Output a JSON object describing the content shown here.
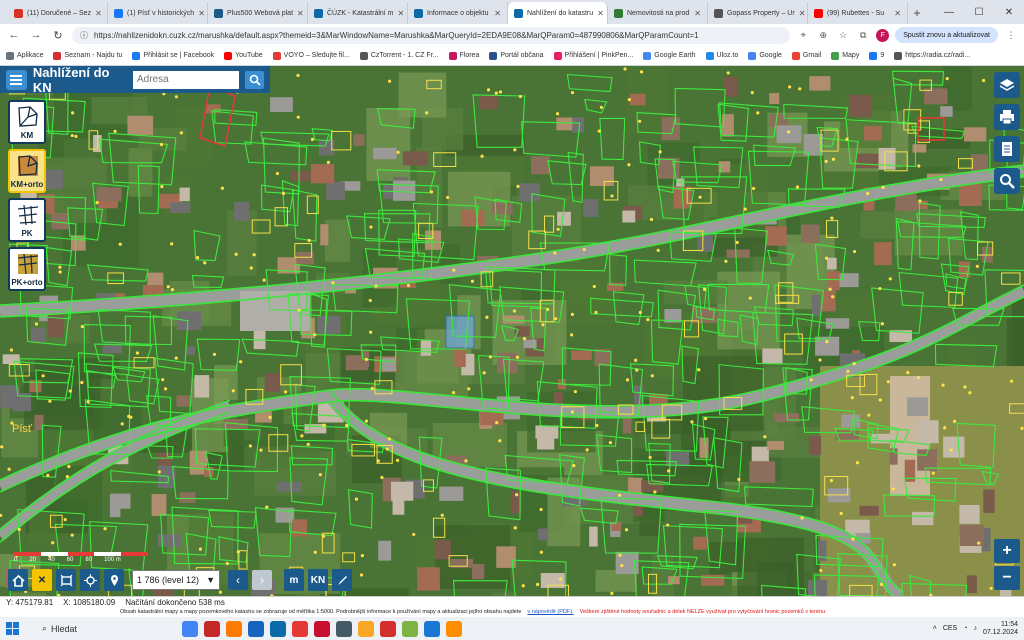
{
  "browser": {
    "tabs": [
      {
        "title": "(11) Doručené – Sez",
        "color": "#d93025"
      },
      {
        "title": "(1) Písť v historických",
        "color": "#1877f2"
      },
      {
        "title": "Plus500 Webová plat",
        "color": "#1c5a8c"
      },
      {
        "title": "ČÚZK - Katastrální m",
        "color": "#0b6aa8"
      },
      {
        "title": "Informace o objektu",
        "color": "#0b6aa8"
      },
      {
        "title": "Nahlížení do katastru",
        "color": "#0b6aa8",
        "active": true
      },
      {
        "title": "Nemovitosti na prod",
        "color": "#2e7d32"
      },
      {
        "title": "Gopass Property – Ur",
        "color": "#555555"
      },
      {
        "title": "(99) Rubettes - Su",
        "color": "#ff0000"
      }
    ],
    "address": "https://nahlizenidokn.cuzk.cz/marushka/default.aspx?themeid=3&MarWindowName=Marushka&MarQueryId=2EDA9E08&MarQParam0=487990806&MarQParamCount=1",
    "update_button": "Spustit znovu a aktualizovat",
    "bookmarks": [
      {
        "label": "Aplikace",
        "color": "#6a7280"
      },
      {
        "label": "Seznam - Najdu tu",
        "color": "#d32f2f"
      },
      {
        "label": "Přihlásit se | Facebook",
        "color": "#1877f2"
      },
      {
        "label": "YouTube",
        "color": "#ff0000"
      },
      {
        "label": "VOYO – Sledujte fil...",
        "color": "#e53935"
      },
      {
        "label": "CzTorrent - 1. CZ Fr...",
        "color": "#555555"
      },
      {
        "label": "Florea",
        "color": "#c2185b"
      },
      {
        "label": "Portál občana",
        "color": "#2b4d8c"
      },
      {
        "label": "Přihlášení | PinkPen...",
        "color": "#e91e63"
      },
      {
        "label": "Google Earth",
        "color": "#4285f4"
      },
      {
        "label": "Uloz.to",
        "color": "#1e88e5"
      },
      {
        "label": "Google",
        "color": "#4285f4"
      },
      {
        "label": "Gmail",
        "color": "#ea4335"
      },
      {
        "label": "Mapy",
        "color": "#43a047"
      },
      {
        "label": "9",
        "color": "#1877f2"
      },
      {
        "label": "https://radia.cz/radi...",
        "color": "#555555"
      }
    ]
  },
  "app": {
    "title": "Nahlížení do KN",
    "search_placeholder": "Adresa",
    "left_tools": [
      {
        "label": "KM",
        "selected": false
      },
      {
        "label": "KM+orto",
        "selected": true
      },
      {
        "label": "PK",
        "selected": false
      },
      {
        "label": "PK+orto",
        "selected": false
      }
    ],
    "place_label": "Písť",
    "scale_ticks": [
      "0",
      "20",
      "40",
      "60",
      "80",
      "100 m"
    ],
    "scale_value": "1 786 (level 12)",
    "bottom_labels": {
      "m": "m",
      "kn": "KN"
    },
    "zoom_in": "+",
    "zoom_out": "−"
  },
  "status": {
    "y": "Y: 475179.81",
    "x": "X: 1085180.09",
    "load": "Načítání dokončeno 538 ms"
  },
  "legal": {
    "text1": "Obsah katastrální mapy a mapy pozemkového katastru se zobrazuje od měřítka 1:5000. Podrobnější informace k používání mapy a aktualizaci jejího obsahu najdete",
    "link": "v nápovědě (PDF).",
    "warning": "Veškeré zjištěné hodnoty souřadnic a délek NELZE využívat pro vytyčování hranic pozemků v terénu."
  },
  "taskbar": {
    "search": "Hledat",
    "lang": "CES",
    "time": "11:54",
    "date": "07.12.2024",
    "apps": [
      "#4285f4",
      "#c62828",
      "#ff7a00",
      "#1565c0",
      "#0b6aa8",
      "#e53935",
      "#c8102e",
      "#455a64",
      "#f9a825",
      "#d32f2f",
      "#7cb342",
      "#1976d2",
      "#ff8f00"
    ]
  }
}
